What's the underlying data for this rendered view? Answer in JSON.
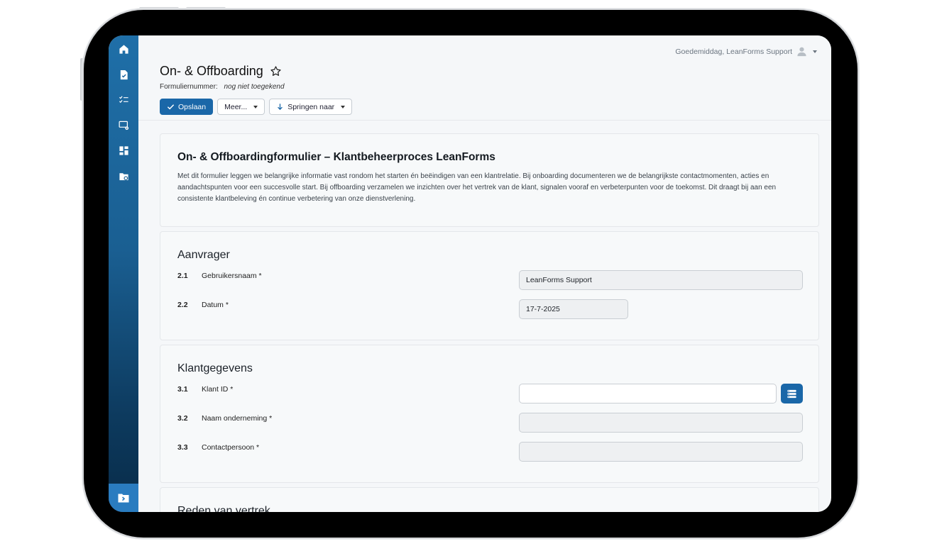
{
  "header": {
    "greeting": "Goedemiddag, LeanForms Support",
    "title": "On- & Offboarding",
    "form_number_label": "Formuliernummer:",
    "form_number_value": "nog niet toegekend"
  },
  "toolbar": {
    "save_label": "Opslaan",
    "more_label": "Meer...",
    "jump_label": "Springen naar"
  },
  "intro": {
    "title": "On- & Offboardingformulier – Klantbeheerproces LeanForms",
    "text": "Met dit formulier leggen we belangrijke informatie vast rondom het starten én beëindigen van een klantrelatie. Bij onboarding documenteren we de belangrijkste contactmomenten, acties en aandachtspunten voor een succesvolle start. Bij offboarding verzamelen we inzichten over het vertrek van de klant, signalen vooraf en verbeterpunten voor de toekomst. Dit draagt bij aan een consistente klantbeleving én continue verbetering van onze dienstverlening."
  },
  "sections": {
    "aanvrager": {
      "title": "Aanvrager",
      "fields": [
        {
          "num": "2.1",
          "label": "Gebruikersnaam *",
          "value": "LeanForms Support"
        },
        {
          "num": "2.2",
          "label": "Datum *",
          "value": "17-7-2025"
        }
      ]
    },
    "klant": {
      "title": "Klantgegevens",
      "fields": [
        {
          "num": "3.1",
          "label": "Klant ID *",
          "value": ""
        },
        {
          "num": "3.2",
          "label": "Naam onderneming *",
          "value": ""
        },
        {
          "num": "3.3",
          "label": "Contactpersoon *",
          "value": ""
        }
      ]
    },
    "reden": {
      "title": "Reden van vertrek"
    }
  },
  "icons": {
    "sidebar": [
      "home-icon",
      "document-check-icon",
      "checklist-icon",
      "screen-settings-icon",
      "dashboard-icon",
      "folder-settings-icon"
    ],
    "sidebar_bottom": "folder-arrow-icon"
  },
  "colors": {
    "primary": "#1a67a8",
    "sidebar_top": "#1f6fa8",
    "sidebar_bottom": "#082b48"
  }
}
